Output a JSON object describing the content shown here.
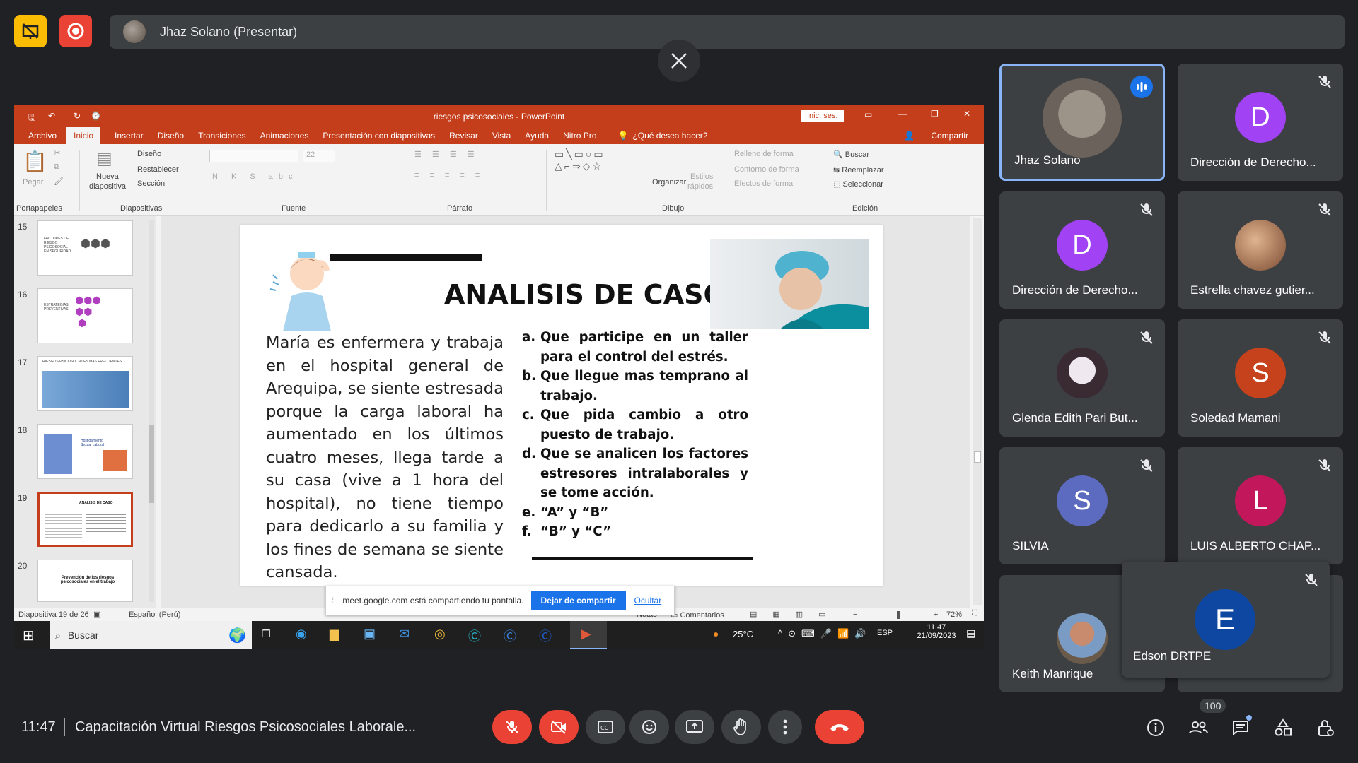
{
  "presenter": {
    "name": "Jhaz Solano (Presentar)"
  },
  "powerpoint": {
    "window_title": "riesgos psicosociales - PowerPoint",
    "signin": "Inic. ses.",
    "tabs": [
      "Archivo",
      "Inicio",
      "Insertar",
      "Diseño",
      "Transiciones",
      "Animaciones",
      "Presentación con diapositivas",
      "Revisar",
      "Vista",
      "Ayuda",
      "Nitro Pro"
    ],
    "tell_me": "¿Qué desea hacer?",
    "share": "Compartir",
    "groups": {
      "portapapeles": "Portapapeles",
      "diapositivas": "Diapositivas",
      "fuente": "Fuente",
      "parrafo": "Párrafo",
      "dibujo": "Dibujo",
      "edicion": "Edición"
    },
    "ribbon": {
      "pegar": "Pegar",
      "nueva": "Nueva",
      "diapositiva": "diapositiva",
      "diseno": "Diseño",
      "restablecer": "Restablecer",
      "seccion": "Sección",
      "font_size": "22",
      "organizar": "Organizar",
      "estilos": "Estilos",
      "rapidos": "rápidos",
      "relleno": "Relleno de forma",
      "contorno": "Contorno de forma",
      "efectos": "Efectos de forma",
      "buscar": "Buscar",
      "reemplazar": "Reemplazar",
      "seleccionar": "Seleccionar"
    },
    "thumbnails": [
      {
        "num": "15",
        "text": "FACTORES DE RIESGO PSICOSOCIAL EN SEGURIDAD"
      },
      {
        "num": "16",
        "text": "ESTRATEGIAS PREVENTIVAS"
      },
      {
        "num": "17",
        "text": "RIESGOS PSICOSOCIALES MAS FRECUENTES"
      },
      {
        "num": "18",
        "text": "Hostigamiento Sexual Laboral"
      },
      {
        "num": "19",
        "text": "ANALISIS DE CASO"
      },
      {
        "num": "20",
        "text": "Prevención de los riesgos psicosociales en el trabajo"
      }
    ],
    "slide": {
      "title": "ANALISIS DE CASO",
      "case_text": "María es enfermera y trabaja en el hospital general de Arequipa, se siente estresada porque la carga laboral ha aumentado en los últimos cuatro meses, llega tarde a su casa (vive a 1 hora del hospital), no tiene tiempo para dedicarlo a su familia y los fines de semana se siente cansada.",
      "options": [
        {
          "letter": "a.",
          "text": "Que participe en un taller para el control del estrés."
        },
        {
          "letter": "b.",
          "text": "Que llegue mas temprano al trabajo."
        },
        {
          "letter": "c.",
          "text": "Que pida cambio a otro puesto de trabajo."
        },
        {
          "letter": "d.",
          "text": "Que se analicen los factores estresores intralaborales y se tome acción."
        },
        {
          "letter": "e.",
          "text": "“A” y “B”"
        },
        {
          "letter": "f.",
          "text": "“B” y “C”"
        }
      ]
    },
    "status": {
      "slide_count": "Diapositiva 19 de 26",
      "language": "Español (Perú)",
      "notes": "Notas",
      "comments": "Comentarios",
      "zoom": "72%"
    },
    "share_notice": {
      "text": "meet.google.com está compartiendo tu pantalla.",
      "stop": "Dejar de compartir",
      "hide": "Ocultar"
    }
  },
  "taskbar": {
    "search": "Buscar",
    "temp": "25°C",
    "lang": "ESP",
    "time": "11:47",
    "date": "21/09/2023"
  },
  "participants": [
    {
      "name": "Jhaz Solano",
      "initial": "",
      "color": "",
      "active": true,
      "photo": true
    },
    {
      "name": "Dirección de Derecho...",
      "initial": "D",
      "color": "#a142f4",
      "active": false,
      "photo": false
    },
    {
      "name": "Dirección de Derecho...",
      "initial": "D",
      "color": "#a142f4",
      "active": false,
      "photo": false
    },
    {
      "name": "Estrella chavez gutier...",
      "initial": "",
      "color": "",
      "active": false,
      "photo": true
    },
    {
      "name": "Glenda Edith Pari But...",
      "initial": "",
      "color": "",
      "active": false,
      "photo": true
    },
    {
      "name": "Soledad Mamani",
      "initial": "S",
      "color": "#c5421c",
      "active": false,
      "photo": false
    },
    {
      "name": "SILVIA",
      "initial": "S",
      "color": "#5c6bc0",
      "active": false,
      "photo": false
    },
    {
      "name": "LUIS ALBERTO CHAP...",
      "initial": "L",
      "color": "#c2185b",
      "active": false,
      "photo": false
    },
    {
      "name": "Keith Manrique",
      "initial": "",
      "color": "",
      "active": false,
      "photo": true
    },
    {
      "name": "Edson DRTPE",
      "initial": "E",
      "color": "#0d47a1",
      "active": false,
      "photo": false
    }
  ],
  "meeting": {
    "time": "11:47",
    "title": "Capacitación Virtual Riesgos Psicosociales Laborale...",
    "people_count": "100"
  }
}
